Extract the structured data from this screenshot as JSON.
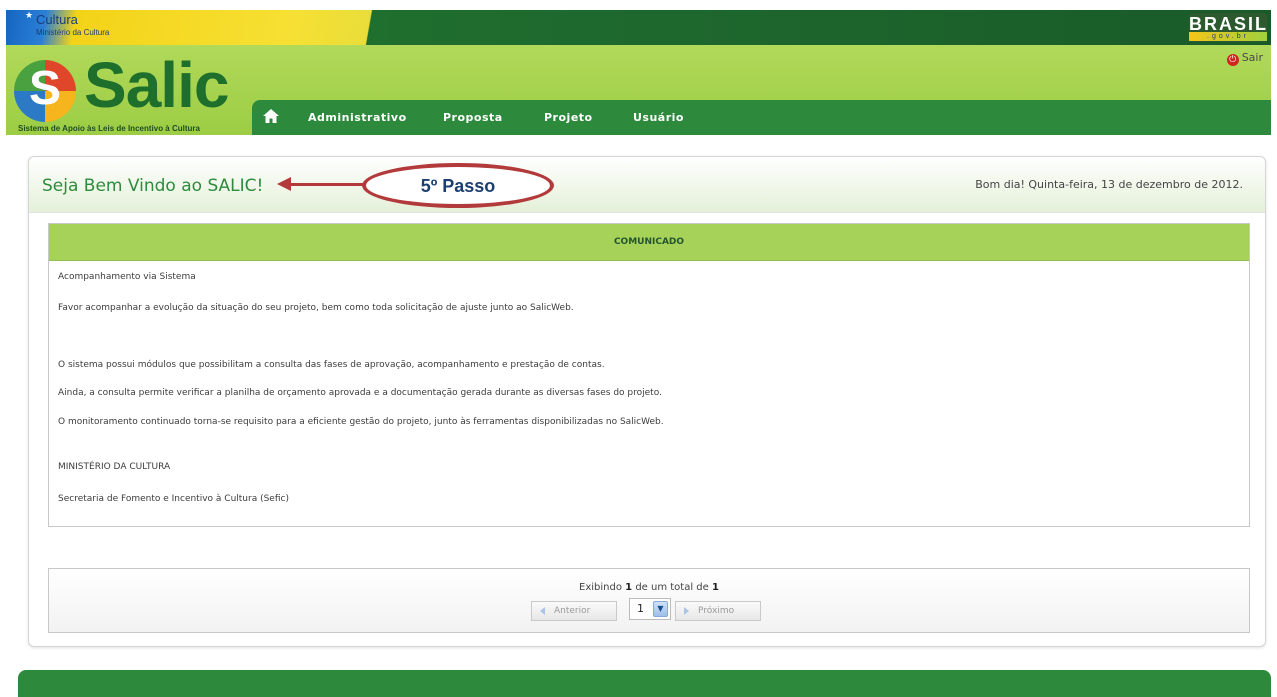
{
  "gov_bar": {
    "ministry_title": "Cultura",
    "ministry_subtitle": "Ministério da Cultura",
    "brasil_logo": "BRASIL",
    "brasil_logo_sub": ".gov.br"
  },
  "header": {
    "logo_word": "Salic",
    "logo_tagline": "Sistema de Apoio às Leis de Incentivo à Cultura",
    "logout_label": "Sair",
    "nav": [
      {
        "label": "Administrativo"
      },
      {
        "label": "Proposta"
      },
      {
        "label": "Projeto"
      },
      {
        "label": "Usuário"
      }
    ]
  },
  "main": {
    "title": "Seja Bem Vindo ao SALIC!",
    "greeting": "Bom dia! Quinta-feira, 13 de dezembro de 2012.",
    "annotation": "5º Passo",
    "comunicado": {
      "header": "COMUNICADO",
      "lines": [
        "Acompanhamento via Sistema",
        "Favor acompanhar a evolução da situação do seu projeto, bem como toda solicitação de ajuste junto ao SalicWeb.",
        "O sistema possui módulos que possibilitam a consulta das fases de aprovação, acompanhamento e prestação de contas.",
        "Ainda, a consulta permite verificar a planilha de orçamento aprovada e a documentação gerada durante as diversas fases do projeto.",
        "O monitoramento continuado torna-se requisito para a eficiente gestão do projeto, junto às ferramentas disponibilizadas no SalicWeb.",
        "MINISTÉRIO DA CULTURA",
        "Secretaria de Fomento e Incentivo à Cultura (Sefic)"
      ]
    },
    "pager": {
      "prefix": "Exibindo",
      "current": "1",
      "middle": "de um total de",
      "total": "1",
      "prev_label": "Anterior",
      "next_label": "Próximo",
      "page_select_value": "1"
    }
  },
  "colors": {
    "primary_green": "#2d8a3c",
    "header_green": "#a2d04a",
    "callout_red": "#b23a3a"
  }
}
